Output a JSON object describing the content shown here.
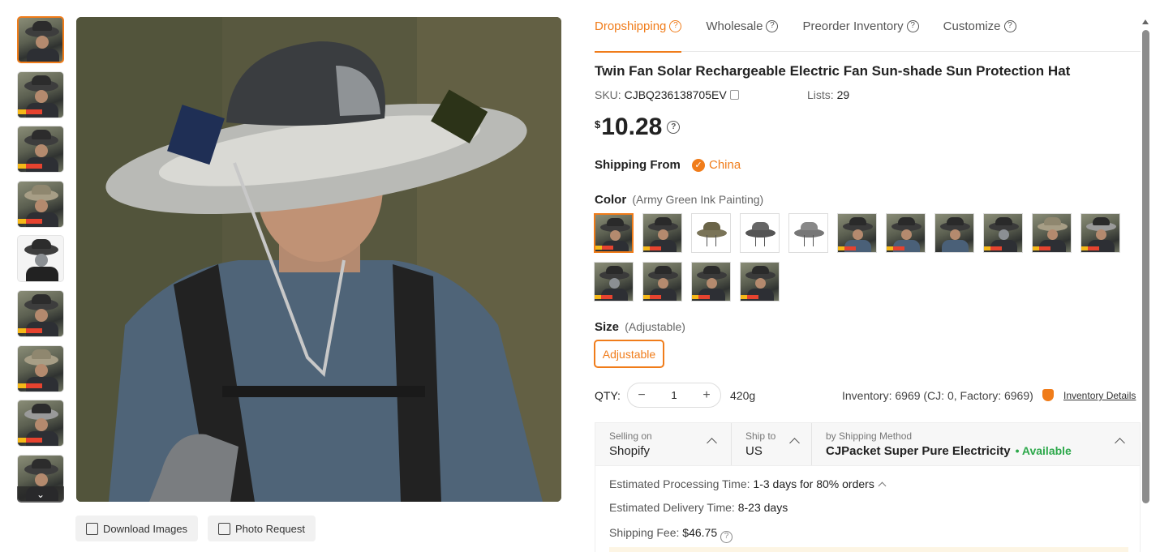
{
  "tabs": [
    {
      "label": "Dropshipping",
      "active": true
    },
    {
      "label": "Wholesale"
    },
    {
      "label": "Preorder Inventory"
    },
    {
      "label": "Customize"
    }
  ],
  "product": {
    "title": "Twin Fan Solar Rechargeable Electric Fan Sun-shade Sun Protection Hat",
    "sku_label": "SKU:",
    "sku": "CJBQ236138705EV",
    "lists_label": "Lists:",
    "lists": "29",
    "currency": "$",
    "price": "10.28"
  },
  "shipping_from": {
    "label": "Shipping From",
    "country": "China"
  },
  "color": {
    "label": "Color",
    "selected": "(Army Green Ink Painting)",
    "swatch_count": 15
  },
  "size": {
    "label": "Size",
    "selected": "(Adjustable)",
    "option": "Adjustable"
  },
  "quantity": {
    "label": "QTY:",
    "value": "1",
    "weight": "420g"
  },
  "inventory": {
    "text": "Inventory: 6969   (CJ: 0, Factory: 6969)",
    "link": "Inventory Details"
  },
  "shipping": {
    "selling_on_label": "Selling on",
    "selling_on": "Shopify",
    "ship_to_label": "Ship to",
    "ship_to": "US",
    "method_label": "by Shipping Method",
    "method": "CJPacket Super Pure Electricity",
    "availability": "• Available",
    "processing_label": "Estimated Processing Time:",
    "processing": "1-3 days for 80% orders",
    "delivery_label": "Estimated Delivery Time:",
    "delivery": "8-23 days",
    "fee_label": "Shipping Fee:",
    "fee": "$46.75"
  },
  "image_actions": {
    "download": "Download Images",
    "photo_request": "Photo Request"
  },
  "colors": {
    "accent": "#f07c1a",
    "available": "#2ca84a"
  }
}
